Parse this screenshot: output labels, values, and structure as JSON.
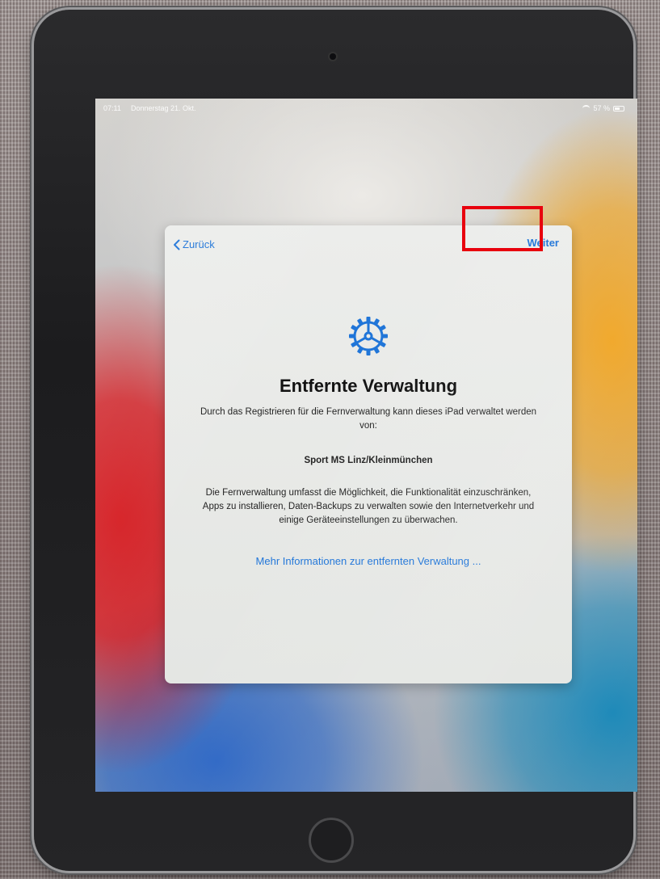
{
  "status_bar": {
    "time": "07:11",
    "date": "Donnerstag 21. Okt.",
    "battery": "57 %",
    "battery_level": 0.57
  },
  "sheet": {
    "back_label": "Zurück",
    "next_label": "Weiter",
    "title": "Entfernte Verwaltung",
    "intro": "Durch das Registrieren für die Fernverwaltung kann dieses iPad verwaltet werden von:",
    "organization": "Sport MS Linz/Kleinmünchen",
    "description": "Die Fernverwaltung umfasst die Möglichkeit, die Funktionalität einzuschränken, Apps zu installieren, Daten-Backups zu verwalten sowie den Internetverkehr und einige Geräteeinstellungen zu überwachen.",
    "more_link": "Mehr Informationen zur entfernten Verwaltung ..."
  },
  "colors": {
    "accent": "#1e74d8",
    "highlight": "#e8000d"
  },
  "icons": {
    "back": "chevron-left-icon",
    "header": "gear-icon"
  }
}
